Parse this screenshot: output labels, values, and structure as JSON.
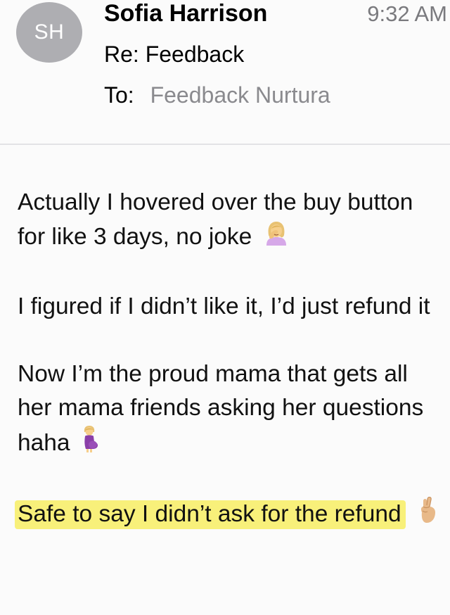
{
  "email": {
    "avatar_initials": "SH",
    "sender": "Sofia Harrison",
    "time": "9:32 AM",
    "subject": "Re: Feedback",
    "to_label": "To:",
    "to_value": "Feedback Nurtura"
  },
  "message": {
    "p1": "Actually I hovered over the buy button for like 3 days, no joke",
    "p2": "I figured if I didn’t like it, I’d just refund it",
    "p3": "Now I’m the proud mama that gets all her mama friends asking her questions haha",
    "p4": "Safe to say I didn’t ask for the refund"
  },
  "icons": {
    "p1_emoji": "face-palm-woman-icon",
    "p3_emoji": "pregnant-woman-icon",
    "p4_emoji": "crossed-fingers-icon"
  },
  "colors": {
    "avatar_bg": "#aeaeb2",
    "highlight": "#f8f07a",
    "muted_text": "#8a8a8e"
  }
}
